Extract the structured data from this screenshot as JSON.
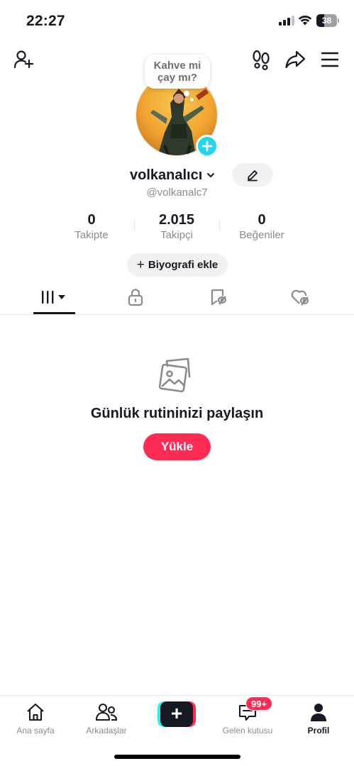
{
  "status_bar": {
    "time": "22:27",
    "battery": "38",
    "battery_level": 0.38
  },
  "note": {
    "text": "Kahve mi\nçay mı?"
  },
  "profile": {
    "display_name": "volkanalıcı",
    "username": "@volkanalc7"
  },
  "stats": [
    {
      "value": "0",
      "label": "Takipte"
    },
    {
      "value": "2.015",
      "label": "Takipçi"
    },
    {
      "value": "0",
      "label": "Beğeniler"
    }
  ],
  "bio_button": {
    "icon": "+",
    "label": "Biyografi ekle"
  },
  "tabs": [
    {
      "icon": "videos-grid-icon",
      "active": true
    },
    {
      "icon": "lock-icon",
      "active": false
    },
    {
      "icon": "saved-icon",
      "active": false
    },
    {
      "icon": "liked-heart-icon",
      "active": false
    }
  ],
  "empty_state": {
    "icon": "photos-icon",
    "title": "Günlük rutininizi paylaşın",
    "button": "Yükle"
  },
  "bottom_nav": {
    "items": [
      {
        "label": "Ana sayfa",
        "icon": "home-icon"
      },
      {
        "label": "Arkadaşlar",
        "icon": "friends-icon"
      },
      {
        "label": "+",
        "icon": "create-icon"
      },
      {
        "label": "Gelen kutusu",
        "icon": "inbox-icon",
        "badge": "99+"
      },
      {
        "label": "Profil",
        "icon": "profile-icon",
        "active": true
      }
    ]
  },
  "colors": {
    "accent": "#fe2c55",
    "cyan": "#25f4ee",
    "avatar_plus": "#20d5ec",
    "text_primary": "#161823",
    "text_secondary": "#8a8b91"
  }
}
